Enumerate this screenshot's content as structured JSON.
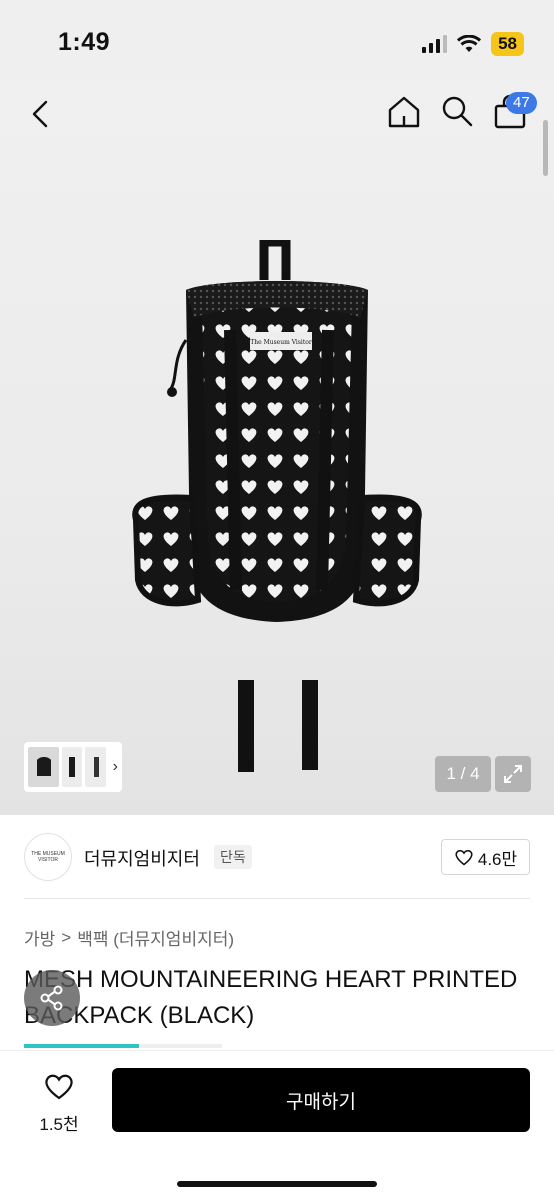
{
  "status": {
    "time": "1:49",
    "battery": "58"
  },
  "nav": {
    "cart_count": "47"
  },
  "gallery": {
    "pager": "1 / 4",
    "logo_text": "The Museum Visitor"
  },
  "brand": {
    "name": "더뮤지엄비지터",
    "tag": "단독",
    "likes": "4.6만",
    "logo_text": "THE MUSEUM VISITOR"
  },
  "breadcrumb": {
    "category": "가방",
    "separator": ">",
    "subcategory": "백팩 (더뮤지엄비지터)"
  },
  "product": {
    "title": "MESH MOUNTAINEERING HEART PRINTED BACKPACK (BLACK)"
  },
  "scroll_progress": 0.58,
  "bottom": {
    "wish_count": "1.5천",
    "buy_label": "구매하기"
  },
  "icons": [
    "back-icon",
    "home-icon",
    "search-icon",
    "cart-icon",
    "heart-icon",
    "expand-icon",
    "share-icon",
    "chevron-right-icon",
    "wifi-icon",
    "signal-icon"
  ]
}
